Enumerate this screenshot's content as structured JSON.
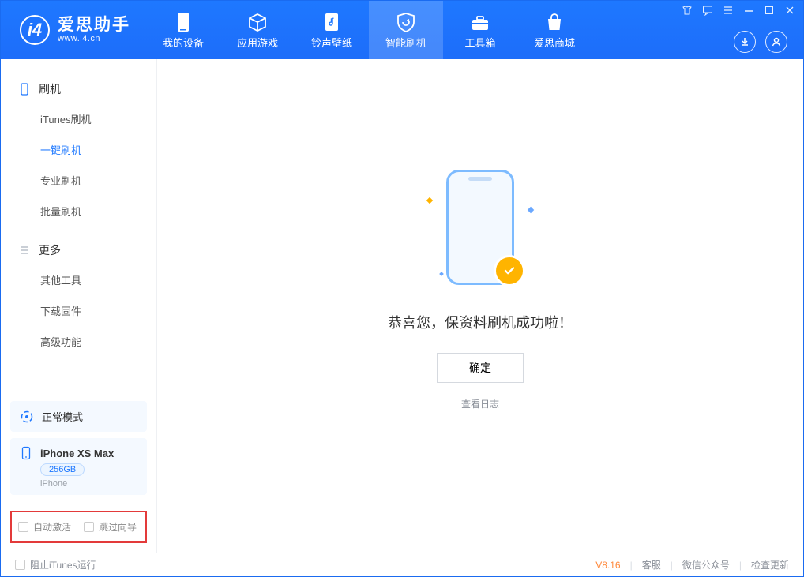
{
  "app": {
    "name": "爱思助手",
    "subtitle": "www.i4.cn",
    "logo_letter": "i4"
  },
  "nav": {
    "items": [
      {
        "label": "我的设备"
      },
      {
        "label": "应用游戏"
      },
      {
        "label": "铃声壁纸"
      },
      {
        "label": "智能刷机"
      },
      {
        "label": "工具箱"
      },
      {
        "label": "爱思商城"
      }
    ]
  },
  "sidebar": {
    "section1": {
      "title": "刷机",
      "items": [
        "iTunes刷机",
        "一键刷机",
        "专业刷机",
        "批量刷机"
      ]
    },
    "section2": {
      "title": "更多",
      "items": [
        "其他工具",
        "下载固件",
        "高级功能"
      ]
    },
    "status": {
      "label": "正常模式"
    },
    "device": {
      "name": "iPhone XS Max",
      "capacity": "256GB",
      "type": "iPhone"
    },
    "checks": {
      "auto_activate": "自动激活",
      "skip_guide": "跳过向导"
    }
  },
  "main": {
    "message": "恭喜您，保资料刷机成功啦！",
    "ok_label": "确定",
    "log_link": "查看日志"
  },
  "statusbar": {
    "block_itunes": "阻止iTunes运行",
    "version": "V8.16",
    "links": [
      "客服",
      "微信公众号",
      "检查更新"
    ]
  }
}
